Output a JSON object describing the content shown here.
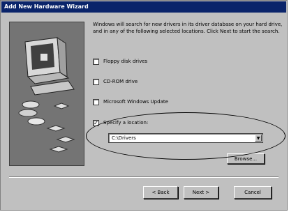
{
  "window": {
    "title": "Add New Hardware Wizard"
  },
  "instructions": "Windows will search for new drivers in its driver database on your hard drive, and in any of the following selected locations. Click Next to start the search.",
  "options": [
    {
      "label": "Floppy disk drives",
      "checked": false
    },
    {
      "label": "CD-ROM drive",
      "checked": false
    },
    {
      "label": "Microsoft Windows Update",
      "checked": false
    },
    {
      "label": "Specify a location:",
      "checked": true
    }
  ],
  "location": {
    "value": "C:\\Drivers"
  },
  "buttons": {
    "browse": "Browse...",
    "back": "< Back",
    "next": "Next >",
    "cancel": "Cancel"
  },
  "colors": {
    "titlebar": "#0a246a",
    "panel": "#747474",
    "face": "#c0c0c0"
  }
}
